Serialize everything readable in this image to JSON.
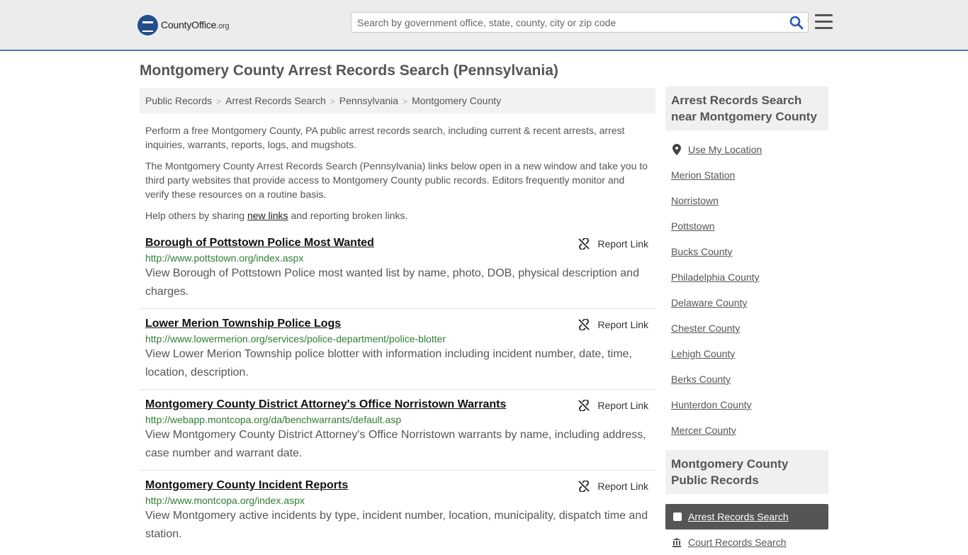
{
  "header": {
    "logo_main": "CountyOffice",
    "logo_tld": ".org",
    "search_placeholder": "Search by government office, state, county, city or zip code"
  },
  "page_title": "Montgomery County Arrest Records Search (Pennsylvania)",
  "breadcrumb": [
    "Public Records",
    "Arrest Records Search",
    "Pennsylvania",
    "Montgomery County"
  ],
  "intro": {
    "p1": "Perform a free Montgomery County, PA public arrest records search, including current & recent arrests, arrest inquiries, warrants, reports, logs, and mugshots.",
    "p2": "The Montgomery County Arrest Records Search (Pennsylvania) links below open in a new window and take you to third party websites that provide access to Montgomery County public records. Editors frequently monitor and verify these resources on a routine basis.",
    "p3_before": "Help others by sharing ",
    "p3_link": "new links",
    "p3_after": " and reporting broken links."
  },
  "report_label": "Report Link",
  "results": [
    {
      "title": "Borough of Pottstown Police Most Wanted",
      "url": "http://www.pottstown.org/index.aspx",
      "desc": "View Borough of Pottstown Police most wanted list by name, photo, DOB, physical description and charges."
    },
    {
      "title": "Lower Merion Township Police Logs",
      "url": "http://www.lowermerion.org/services/police-department/police-blotter",
      "desc": "View Lower Merion Township police blotter with information including incident number, date, time, location, description."
    },
    {
      "title": "Montgomery County District Attorney's Office Norristown Warrants",
      "url": "http://webapp.montcopa.org/da/benchwarrants/default.asp",
      "desc": "View Montgomery County District Attorney's Office Norristown warrants by name, including address, case number and warrant date."
    },
    {
      "title": "Montgomery County Incident Reports",
      "url": "http://www.montcopa.org/index.aspx",
      "desc": "View Montgomery active incidents by type, incident number, location, municipality, dispatch time and station."
    }
  ],
  "sidebar": {
    "nearby_heading": "Arrest Records Search near Montgomery County",
    "use_location": "Use My Location",
    "nearby": [
      "Merion Station",
      "Norristown",
      "Pottstown",
      "Bucks County",
      "Philadelphia County",
      "Delaware County",
      "Chester County",
      "Lehigh County",
      "Berks County",
      "Hunterdon County",
      "Mercer County"
    ],
    "public_heading": "Montgomery County Public Records",
    "active_item": "Arrest Records Search",
    "next_item": "Court Records Search"
  },
  "colors": {
    "accent_border": "#4a76b8",
    "logo_badge": "#234e8c",
    "url_green": "#2e7d32",
    "active_bg": "#555555"
  }
}
